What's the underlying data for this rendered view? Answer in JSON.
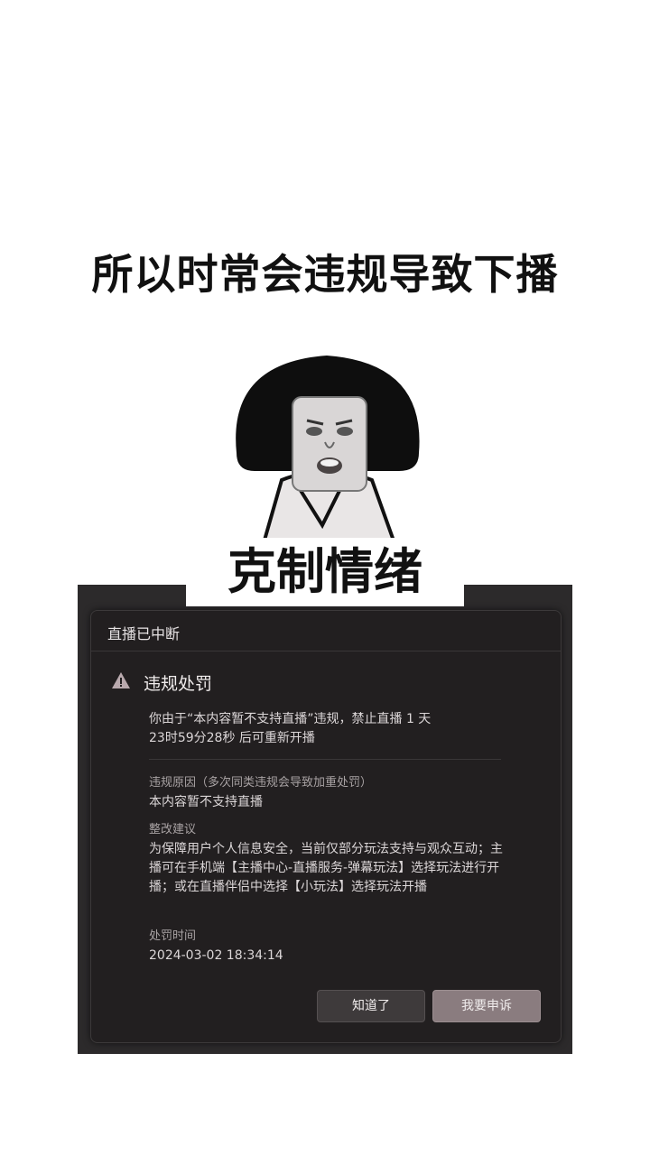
{
  "heading": "所以时常会违规导致下播",
  "caption": "克制情绪",
  "dialog": {
    "title": "直播已中断",
    "section_title": "违规处罚",
    "warning_icon": "warning-triangle-icon",
    "message_line1": "你由于“本内容暂不支持直播”违规，禁止直播 1 天",
    "message_line2": "23时59分28秒 后可重新开播",
    "reason_label": "违规原因（多次同类违规会导致加重处罚）",
    "reason_value": "本内容暂不支持直播",
    "advice_label": "整改建议",
    "advice_text": "为保障用户个人信息安全，当前仅部分玩法支持与观众互动；主播可在手机端【主播中心-直播服务-弹幕玩法】选择玩法进行开播；或在直播伴侣中选择【小玩法】选择玩法开播",
    "time_label": "处罚时间",
    "time_value": "2024-03-02 18:34:14",
    "ok_button": "知道了",
    "appeal_button": "我要申诉"
  },
  "colors": {
    "dialog_bg": "#221f20",
    "appeal_button": "#8a7c7f",
    "warning_icon": "#b9a9ad"
  }
}
